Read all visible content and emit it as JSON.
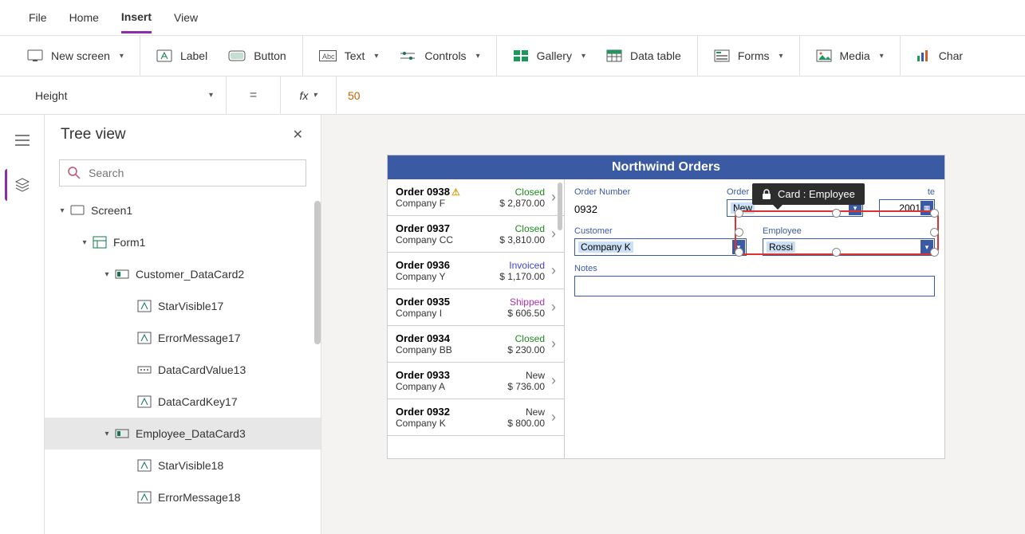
{
  "menubar": {
    "items": [
      "File",
      "Home",
      "Insert",
      "View"
    ],
    "active": 2
  },
  "ribbon": [
    {
      "label": "New screen",
      "icon": "screen",
      "chev": true
    },
    {
      "label": "Label",
      "icon": "label"
    },
    {
      "label": "Button",
      "icon": "button"
    },
    {
      "label": "Text",
      "icon": "text",
      "chev": true
    },
    {
      "label": "Controls",
      "icon": "controls",
      "chev": true
    },
    {
      "label": "Gallery",
      "icon": "gallery",
      "chev": true
    },
    {
      "label": "Data table",
      "icon": "datatable"
    },
    {
      "label": "Forms",
      "icon": "forms",
      "chev": true
    },
    {
      "label": "Media",
      "icon": "media",
      "chev": true
    },
    {
      "label": "Chart",
      "icon": "chart",
      "truncated": "Char"
    }
  ],
  "formula": {
    "property": "Height",
    "value": "50"
  },
  "tree": {
    "title": "Tree view",
    "search_ph": "Search",
    "nodes": [
      {
        "depth": 0,
        "label": "Screen1",
        "icon": "screen",
        "caret": "down"
      },
      {
        "depth": 1,
        "label": "Form1",
        "icon": "form",
        "caret": "down"
      },
      {
        "depth": 2,
        "label": "Customer_DataCard2",
        "icon": "card",
        "caret": "down"
      },
      {
        "depth": 3,
        "label": "StarVisible17",
        "icon": "ctrl"
      },
      {
        "depth": 3,
        "label": "ErrorMessage17",
        "icon": "ctrl"
      },
      {
        "depth": 3,
        "label": "DataCardValue13",
        "icon": "combo"
      },
      {
        "depth": 3,
        "label": "DataCardKey17",
        "icon": "ctrl"
      },
      {
        "depth": 2,
        "label": "Employee_DataCard3",
        "icon": "card",
        "caret": "down",
        "selected": true
      },
      {
        "depth": 3,
        "label": "StarVisible18",
        "icon": "ctrl"
      },
      {
        "depth": 3,
        "label": "ErrorMessage18",
        "icon": "ctrl"
      }
    ]
  },
  "app": {
    "title": "Northwind Orders",
    "orders": [
      {
        "num": "Order 0938",
        "co": "Company F",
        "status": "Closed",
        "amt": "$ 2,870.00",
        "warn": true
      },
      {
        "num": "Order 0937",
        "co": "Company CC",
        "status": "Closed",
        "amt": "$ 3,810.00"
      },
      {
        "num": "Order 0936",
        "co": "Company Y",
        "status": "Invoiced",
        "amt": "$ 1,170.00"
      },
      {
        "num": "Order 0935",
        "co": "Company I",
        "status": "Shipped",
        "amt": "$ 606.50"
      },
      {
        "num": "Order 0934",
        "co": "Company BB",
        "status": "Closed",
        "amt": "$ 230.00"
      },
      {
        "num": "Order 0933",
        "co": "Company A",
        "status": "New",
        "amt": "$ 736.00"
      },
      {
        "num": "Order 0932",
        "co": "Company K",
        "status": "New",
        "amt": "$ 800.00"
      }
    ],
    "form": {
      "order_number_lbl": "Order Number",
      "order_number": "0932",
      "order_status_lbl": "Order Status",
      "order_status": "New",
      "order_date_lbl": "Order Date",
      "order_date": "2001",
      "customer_lbl": "Customer",
      "customer": "Company K",
      "employee_lbl": "Employee",
      "employee": "Rossi",
      "notes_lbl": "Notes"
    }
  },
  "tooltip": "Card : Employee"
}
